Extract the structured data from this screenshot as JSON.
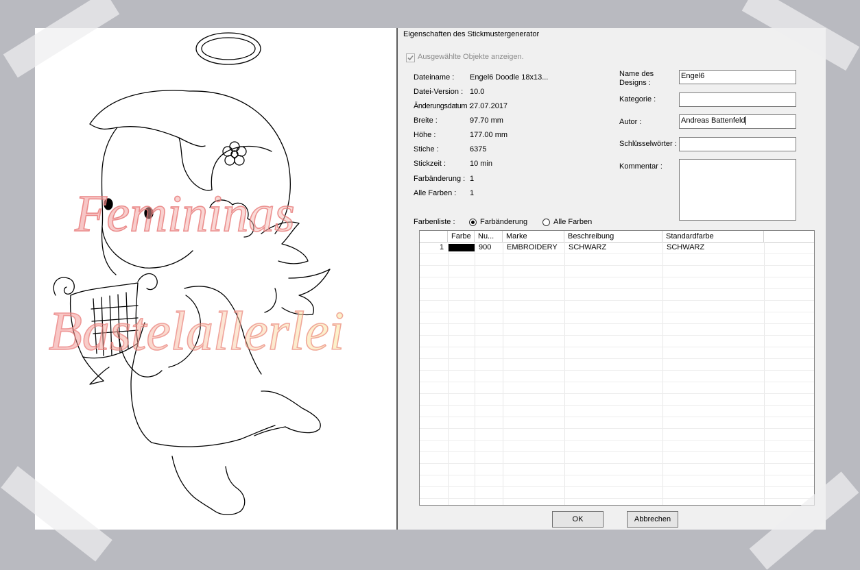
{
  "dialog": {
    "title": "Eigenschaften des Stickmustergenerator",
    "show_selected_label": "Ausgewählte Objekte anzeigen.",
    "show_selected_checked": true
  },
  "info": [
    {
      "label": "Dateiname :",
      "value": "Engel6 Doodle 18x13..."
    },
    {
      "label": "Datei-Version :",
      "value": "10.0"
    },
    {
      "label": "Änderungsdatum :",
      "value": "27.07.2017"
    },
    {
      "label": "Breite :",
      "value": "97.70 mm"
    },
    {
      "label": "Höhe :",
      "value": "177.00 mm"
    },
    {
      "label": "Stiche :",
      "value": "6375"
    },
    {
      "label": "Stickzeit :",
      "value": "10 min"
    },
    {
      "label": "Farbänderung :",
      "value": "1"
    },
    {
      "label": "Alle Farben :",
      "value": "1"
    }
  ],
  "fields": {
    "design_name_label": "Name des\nDesigns :",
    "design_name": "Engel6",
    "category_label": "Kategorie :",
    "category": "",
    "author_label": "Autor :",
    "author": "Andreas Battenfeld",
    "keywords_label": "Schlüsselwörter :",
    "keywords": "",
    "comment_label": "Kommentar :",
    "comment": ""
  },
  "colorlist": {
    "label": "Farbenliste :",
    "option_change": "Farbänderung",
    "option_all": "Alle Farben",
    "selected": "Farbänderung"
  },
  "table": {
    "columns": [
      "",
      "Farbe",
      "Nu...",
      "Marke",
      "Beschreibung",
      "Standardfarbe"
    ],
    "rows": [
      {
        "index": "1",
        "color": "#000000",
        "number": "900",
        "brand": "EMBROIDERY",
        "description": "SCHWARZ",
        "standard": "SCHWARZ"
      }
    ]
  },
  "buttons": {
    "ok": "OK",
    "cancel": "Abbrechen"
  },
  "watermark": {
    "line1": "Femininas",
    "line2": "Bastelallerlei"
  },
  "colors": {
    "background": "#b9bac0",
    "dialog": "#f0f0f0",
    "canvas": "#ffffff"
  }
}
